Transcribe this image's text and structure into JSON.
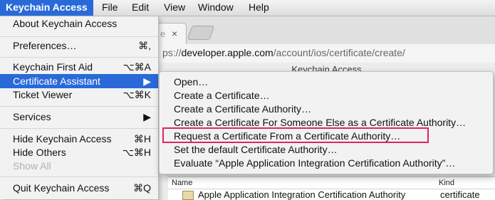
{
  "menubar": {
    "items": [
      "Keychain Access",
      "File",
      "Edit",
      "View",
      "Window",
      "Help"
    ]
  },
  "browser": {
    "tab_partial_text": "e",
    "tab_close_glyph": "×",
    "url_prefix": "ps://",
    "url_host": "developer.apple.com",
    "url_path": "/account/ios/certificate/create/"
  },
  "keychain_window": {
    "title": "Keychain Access",
    "columns": [
      "Name",
      "Kind"
    ],
    "rows": [
      {
        "name": "Apple Application Integration Certification Authority",
        "kind": "certificate"
      }
    ]
  },
  "app_menu": {
    "items": [
      {
        "label": "About Keychain Access",
        "shortcut": ""
      },
      {
        "label": "Preferences…",
        "shortcut": "⌘,"
      },
      {
        "label": "Keychain First Aid",
        "shortcut": "⌥⌘A"
      },
      {
        "label": "Certificate Assistant",
        "shortcut": "▶"
      },
      {
        "label": "Ticket Viewer",
        "shortcut": "⌥⌘K"
      },
      {
        "label": "Services",
        "shortcut": "▶"
      },
      {
        "label": "Hide Keychain Access",
        "shortcut": "⌘H"
      },
      {
        "label": "Hide Others",
        "shortcut": "⌥⌘H"
      },
      {
        "label": "Show All",
        "shortcut": ""
      },
      {
        "label": "Quit Keychain Access",
        "shortcut": "⌘Q"
      }
    ]
  },
  "submenu": {
    "items": [
      "Open…",
      "Create a Certificate…",
      "Create a Certificate Authority…",
      "Create a Certificate For Someone Else as a Certificate Authority…",
      "Request a Certificate From a Certificate Authority…",
      "Set the default Certificate Authority…",
      "Evaluate “Apple Application Integration Certification Authority”…"
    ]
  },
  "colors": {
    "menu_highlight": "#2a6ad8",
    "annotation_box": "#e0255e"
  }
}
